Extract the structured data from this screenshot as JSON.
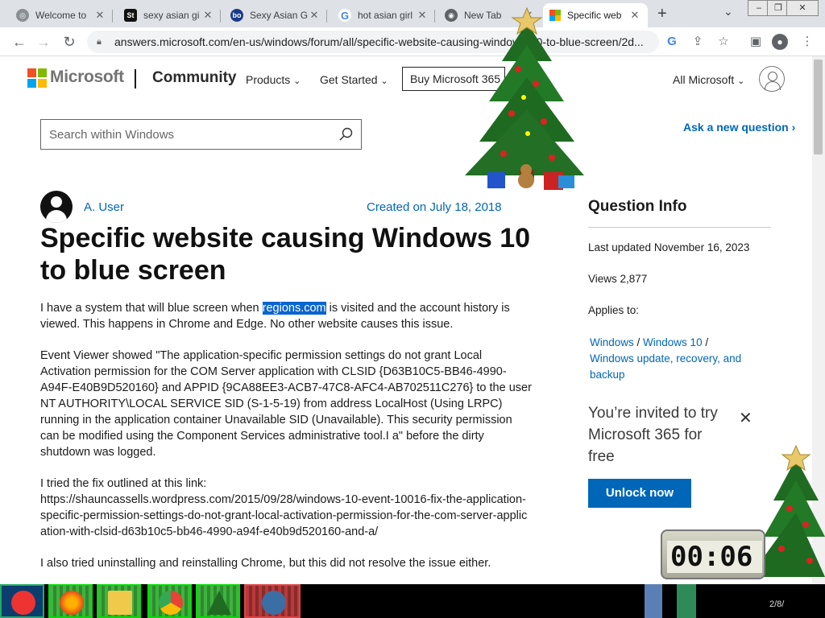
{
  "browser": {
    "tabs": [
      {
        "title": "Welcome to",
        "favicon": "globe-icon",
        "color": "#5f6368"
      },
      {
        "title": "sexy asian gi",
        "favicon": "st-icon",
        "color": "#111111"
      },
      {
        "title": "Sexy Asian G",
        "favicon": "bol-icon",
        "color": "#1a3a8a"
      },
      {
        "title": "hot asian girl",
        "favicon": "google-icon",
        "color": "#4285f4"
      },
      {
        "title": "New Tab",
        "favicon": "chrome-icon",
        "color": "#5f6368"
      },
      {
        "title": "Specific web",
        "favicon": "microsoft-icon",
        "color": "#f25022",
        "active": true
      }
    ],
    "new_tab_symbol": "+",
    "url": "answers.microsoft.com/en-us/windows/forum/all/specific-website-causing-windows-10-to-blue-screen/2d..."
  },
  "site": {
    "brand": "Microsoft",
    "section": "Community",
    "nav": [
      "Products",
      "Get Started"
    ],
    "buy_label": "Buy Microsoft 365",
    "all_ms": "All Microsoft",
    "search_placeholder": "Search within Windows",
    "ask_label": "Ask a new question"
  },
  "question": {
    "author": "A. User",
    "created": "Created on July 18, 2018",
    "title": "Specific website causing Windows 10 to blue screen",
    "p1_before": "I have a system that will blue screen when ",
    "p1_link": "regions.com",
    "p1_after": " is visited and the account history is viewed. This happens in Chrome and Edge. No other website causes this issue.",
    "p2": "Event Viewer showed \"The application-specific permission settings do not grant Local Activation permission for the COM Server application with CLSID {D63B10C5-BB46-4990-A94F-E40B9D520160} and APPID {9CA88EE3-ACB7-47C8-AFC4-AB702511C276} to the user NT AUTHORITY\\LOCAL SERVICE SID (S-1-5-19) from address LocalHost (Using LRPC) running in the application container Unavailable SID (Unavailable). This security permission can be modified using the Component Services administrative tool.I a\" before the dirty shutdown was logged.",
    "p3_intro": "I tried the fix outlined at this link:",
    "p3_link": "https://shauncassells.wordpress.com/2015/09/28/windows-10-event-10016-fix-the-application-specific-permission-settings-do-not-grant-local-activation-permission-for-the-com-server-application-with-clsid-d63b10c5-bb46-4990-a94f-e40b9d520160-and-a/",
    "p4": "I also tried uninstalling and reinstalling Chrome, but this did not resolve the issue either."
  },
  "sidebar": {
    "title": "Question Info",
    "last_updated": "Last updated November 16, 2023",
    "views": "Views 2,877",
    "applies_label": "Applies to:",
    "applies": [
      "Windows",
      "Windows 10",
      "Windows update, recovery, and backup"
    ],
    "invite": "You’re invited to try Microsoft 365 for free",
    "unlock_label": "Unlock now"
  },
  "desktop": {
    "clock_text": "00:06",
    "tray_text": "2/8/"
  }
}
